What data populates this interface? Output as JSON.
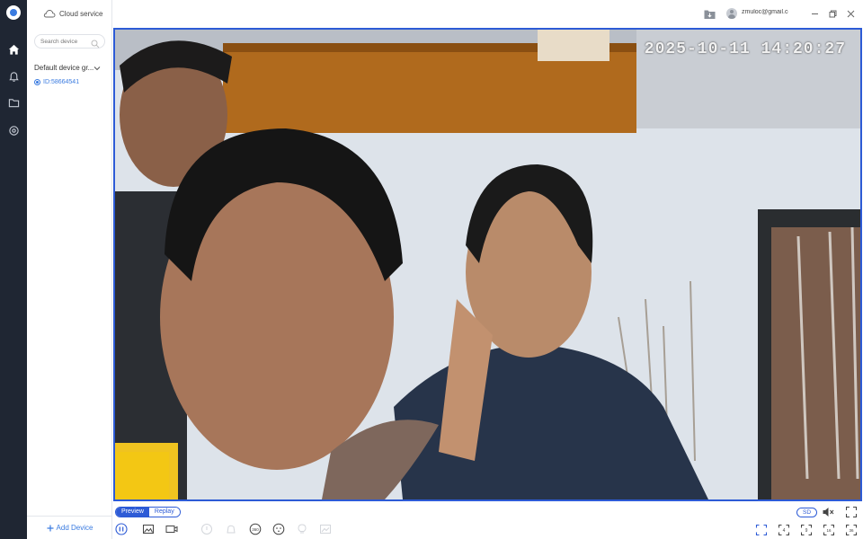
{
  "sidebar": {
    "cloud_label": "Cloud service",
    "search_placeholder": "Search device",
    "group_label": "Default device gr...",
    "device_id": "ID:58664541",
    "add_device_label": "Add Device"
  },
  "titlebar": {
    "email": "zmuloc@gmail.co"
  },
  "video": {
    "timestamp": "2025-10-11 14:20:27"
  },
  "controls": {
    "tabs": [
      {
        "label": "Preview",
        "active": true
      },
      {
        "label": "Replay",
        "active": false
      }
    ],
    "quality": "SD"
  },
  "colors": {
    "accent": "#2d5bd6",
    "rail": "#1f2633"
  },
  "icons": {
    "rail": [
      "home-icon",
      "bell-icon",
      "folder-icon",
      "settings-icon"
    ],
    "left_controls": [
      "pause-icon",
      "snapshot-icon",
      "record-icon",
      "talk-icon",
      "alarm-icon",
      "ptz-360-icon",
      "face-icon",
      "light-icon",
      "gallery-icon"
    ],
    "right_controls": [
      "mute-icon",
      "fullscreen-icon",
      "layout-1-icon",
      "layout-4-icon",
      "layout-9-icon",
      "layout-16-icon",
      "layout-36-icon"
    ]
  }
}
